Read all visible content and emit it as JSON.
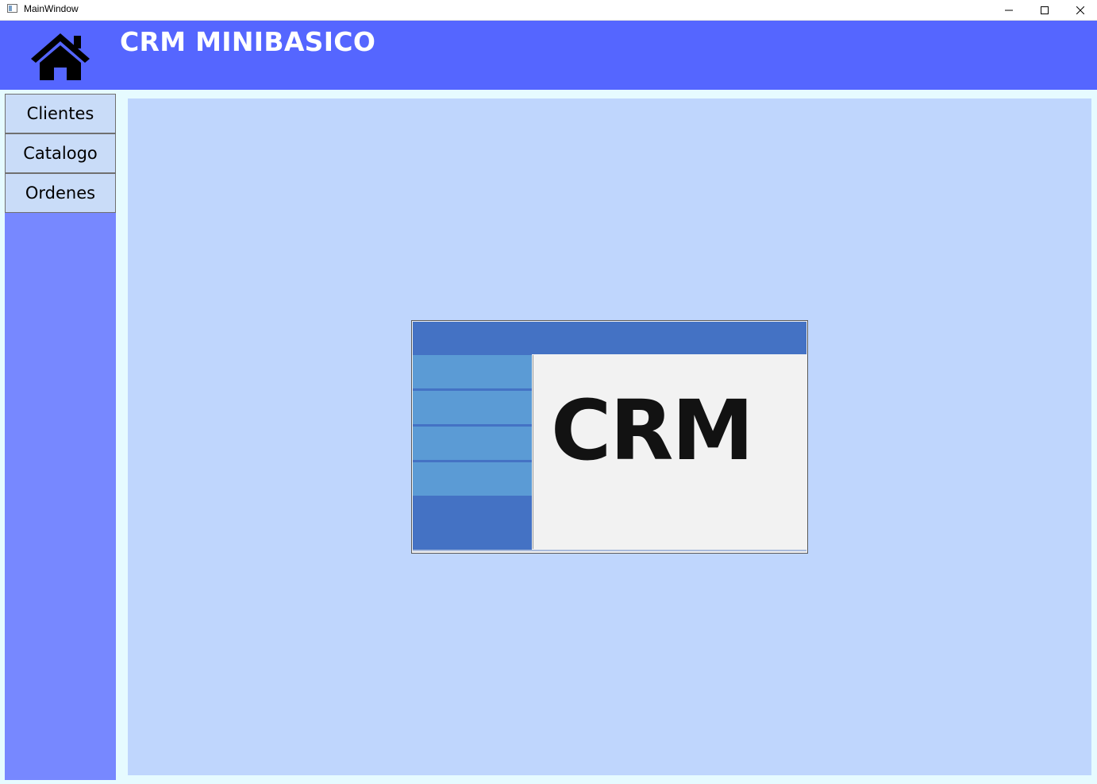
{
  "window": {
    "title": "MainWindow"
  },
  "header": {
    "app_title": "CRM MINIBASICO",
    "home_icon": "home-icon",
    "background": "#5566ff"
  },
  "sidebar": {
    "background": "#7788ff",
    "items": [
      {
        "label": "Clientes"
      },
      {
        "label": "Catalogo"
      },
      {
        "label": "Ordenes"
      }
    ]
  },
  "main": {
    "background": "#bfd6fd",
    "logo": {
      "text": "CRM",
      "accent_dark": "#4472c4",
      "accent_light": "#5b9bd5"
    }
  }
}
